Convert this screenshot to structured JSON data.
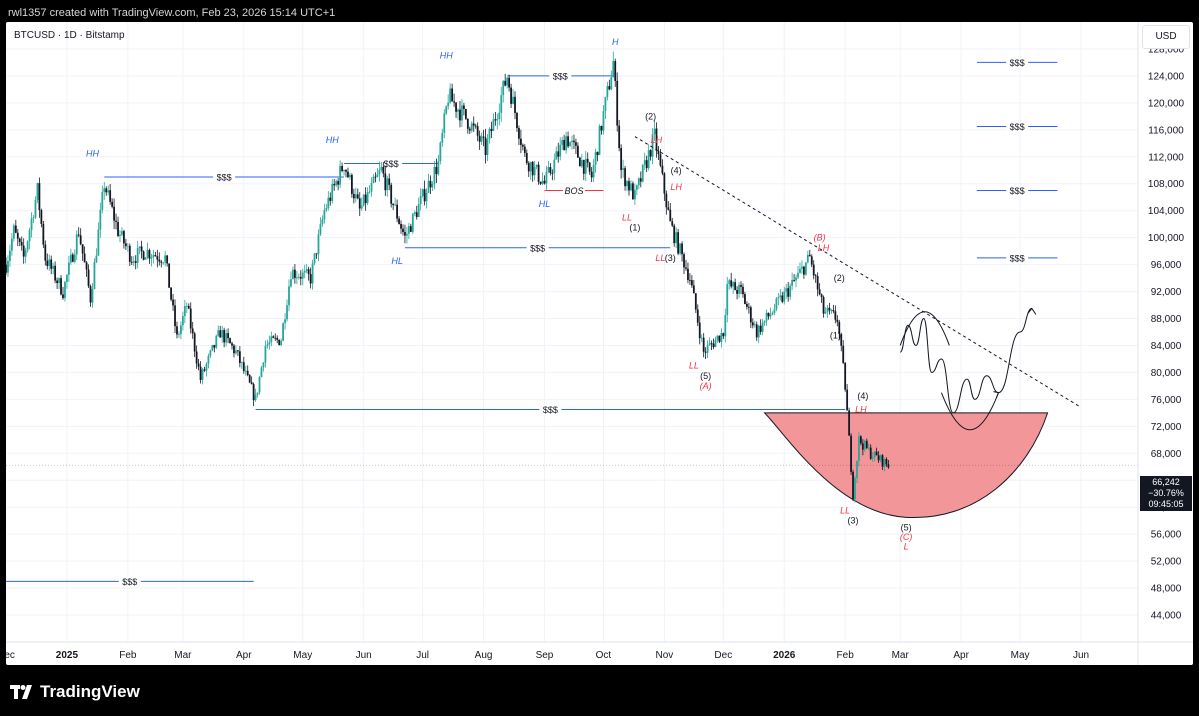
{
  "header": {
    "credit": "rwl1357 created with TradingView.com, Feb 23, 2026 15:14 UTC+1"
  },
  "chart": {
    "symbol": "BTCUSD · 1D · Bitstamp",
    "currency": "USD"
  },
  "price_badge": {
    "price": "66,242",
    "change": "−30.76%",
    "countdown": "09:45:05"
  },
  "footer": {
    "brand": "TradingView"
  },
  "colors": {
    "up": "#26a69a",
    "down": "#131722",
    "liquidity": "#2962ff",
    "structure_blue": "#2962ff",
    "structure_red": "#f23645",
    "zone": "#f28b8e",
    "wave": "#131722"
  },
  "chart_data": {
    "type": "candlestick",
    "ylim": [
      40000,
      132000
    ],
    "y_ticks": [
      44000,
      48000,
      52000,
      56000,
      60000,
      64000,
      68000,
      72000,
      76000,
      80000,
      84000,
      88000,
      92000,
      96000,
      100000,
      104000,
      108000,
      112000,
      116000,
      120000,
      124000,
      128000
    ],
    "y_tick_labels": [
      "44,000",
      "48,000",
      "52,000",
      "56,000",
      "60,000",
      "64,000",
      "68,000",
      "72,000",
      "76,000",
      "80,000",
      "84,000",
      "88,000",
      "92,000",
      "96,000",
      "100,000",
      "104,000",
      "108,000",
      "112,000",
      "116,000",
      "120,000",
      "124,000",
      "128,000"
    ],
    "x_range": [
      "2024-12-01",
      "2026-06-30"
    ],
    "x_ticks": [
      {
        "label": "Dec",
        "date": "2024-12-01",
        "bold": false
      },
      {
        "label": "2025",
        "date": "2025-01-01",
        "bold": true
      },
      {
        "label": "Feb",
        "date": "2025-02-01",
        "bold": false
      },
      {
        "label": "Mar",
        "date": "2025-03-01",
        "bold": false
      },
      {
        "label": "Apr",
        "date": "2025-04-01",
        "bold": false
      },
      {
        "label": "May",
        "date": "2025-05-01",
        "bold": false
      },
      {
        "label": "Jun",
        "date": "2025-06-01",
        "bold": false
      },
      {
        "label": "Jul",
        "date": "2025-07-01",
        "bold": false
      },
      {
        "label": "Aug",
        "date": "2025-08-01",
        "bold": false
      },
      {
        "label": "Sep",
        "date": "2025-09-01",
        "bold": false
      },
      {
        "label": "Oct",
        "date": "2025-10-01",
        "bold": false
      },
      {
        "label": "Nov",
        "date": "2025-11-01",
        "bold": false
      },
      {
        "label": "Dec",
        "date": "2025-12-01",
        "bold": false
      },
      {
        "label": "2026",
        "date": "2026-01-01",
        "bold": true
      },
      {
        "label": "Feb",
        "date": "2026-02-01",
        "bold": false
      },
      {
        "label": "Mar",
        "date": "2026-03-01",
        "bold": false
      },
      {
        "label": "Apr",
        "date": "2026-04-01",
        "bold": false
      },
      {
        "label": "May",
        "date": "2026-05-01",
        "bold": false
      },
      {
        "label": "Jun",
        "date": "2026-06-01",
        "bold": false
      }
    ],
    "price_path": [
      [
        "2024-12-01",
        96000
      ],
      [
        "2024-12-05",
        101000
      ],
      [
        "2024-12-10",
        97000
      ],
      [
        "2024-12-17",
        107000
      ],
      [
        "2024-12-21",
        97000
      ],
      [
        "2024-12-30",
        92000
      ],
      [
        "2025-01-07",
        101000
      ],
      [
        "2025-01-13",
        91000
      ],
      [
        "2025-01-20",
        108000
      ],
      [
        "2025-01-27",
        101000
      ],
      [
        "2025-02-03",
        97000
      ],
      [
        "2025-02-10",
        98000
      ],
      [
        "2025-02-20",
        97000
      ],
      [
        "2025-02-26",
        85000
      ],
      [
        "2025-03-03",
        90000
      ],
      [
        "2025-03-10",
        79000
      ],
      [
        "2025-03-20",
        86000
      ],
      [
        "2025-03-28",
        83000
      ],
      [
        "2025-04-07",
        76000
      ],
      [
        "2025-04-12",
        84000
      ],
      [
        "2025-04-20",
        85000
      ],
      [
        "2025-04-25",
        95000
      ],
      [
        "2025-05-05",
        94000
      ],
      [
        "2025-05-12",
        104000
      ],
      [
        "2025-05-22",
        111000
      ],
      [
        "2025-05-30",
        104000
      ],
      [
        "2025-06-10",
        110000
      ],
      [
        "2025-06-22",
        100000
      ],
      [
        "2025-07-01",
        106000
      ],
      [
        "2025-07-09",
        111000
      ],
      [
        "2025-07-14",
        121000
      ],
      [
        "2025-07-25",
        117000
      ],
      [
        "2025-08-02",
        113000
      ],
      [
        "2025-08-13",
        124000
      ],
      [
        "2025-08-22",
        112000
      ],
      [
        "2025-09-01",
        108000
      ],
      [
        "2025-09-12",
        115000
      ],
      [
        "2025-09-25",
        109000
      ],
      [
        "2025-10-06",
        126000
      ],
      [
        "2025-10-10",
        110000
      ],
      [
        "2025-10-17",
        106000
      ],
      [
        "2025-10-27",
        115000
      ],
      [
        "2025-11-04",
        102000
      ],
      [
        "2025-11-14",
        94000
      ],
      [
        "2025-11-21",
        83000
      ],
      [
        "2025-12-01",
        86000
      ],
      [
        "2025-12-03",
        93000
      ],
      [
        "2025-12-10",
        92000
      ],
      [
        "2025-12-18",
        86000
      ],
      [
        "2026-01-05",
        93000
      ],
      [
        "2026-01-14",
        97000
      ],
      [
        "2026-01-21",
        89000
      ],
      [
        "2026-01-28",
        88000
      ],
      [
        "2026-02-01",
        78000
      ],
      [
        "2026-02-05",
        62000
      ],
      [
        "2026-02-08",
        70000
      ],
      [
        "2026-02-14",
        68000
      ],
      [
        "2026-02-23",
        66242
      ]
    ],
    "liquidity_levels": [
      {
        "label": "$$$",
        "price": 49000,
        "from": "2024-12-01",
        "to": "2025-04-06"
      },
      {
        "label": "$$$",
        "price": 109000,
        "from": "2025-01-20",
        "to": "2025-05-22"
      },
      {
        "label": "$$$",
        "price": 111000,
        "from": "2025-05-22",
        "to": "2025-07-09"
      },
      {
        "label": "$$$",
        "price": 124000,
        "from": "2025-08-13",
        "to": "2025-10-06"
      },
      {
        "label": "$$$",
        "price": 98500,
        "from": "2025-06-22",
        "to": "2025-11-04"
      },
      {
        "label": "$$$",
        "price": 74500,
        "from": "2025-04-07",
        "to": "2026-02-01"
      },
      {
        "label": "$$$",
        "price": 126000,
        "from": "2026-04-09",
        "to": "2026-05-20"
      },
      {
        "label": "$$$",
        "price": 116500,
        "from": "2026-04-09",
        "to": "2026-05-20"
      },
      {
        "label": "$$$",
        "price": 107000,
        "from": "2026-04-09",
        "to": "2026-05-20"
      },
      {
        "label": "$$$",
        "price": 97000,
        "from": "2026-04-09",
        "to": "2026-05-20"
      }
    ],
    "bos": {
      "label": "BOS",
      "price": 107000,
      "from": "2025-09-01",
      "to": "2025-10-01"
    },
    "annotations": [
      {
        "text": "HH",
        "date": "2025-01-14",
        "price": 112500,
        "color": "blue"
      },
      {
        "text": "HH",
        "date": "2025-05-16",
        "price": 114500,
        "color": "blue"
      },
      {
        "text": "HH",
        "date": "2025-07-13",
        "price": 127000,
        "color": "blue"
      },
      {
        "text": "H",
        "date": "2025-10-07",
        "price": 129000,
        "color": "blue"
      },
      {
        "text": "HL",
        "date": "2025-06-18",
        "price": 96500,
        "color": "blue"
      },
      {
        "text": "HL",
        "date": "2025-09-01",
        "price": 105000,
        "color": "blue"
      },
      {
        "text": "LH",
        "date": "2025-10-28",
        "price": 114500,
        "color": "red"
      },
      {
        "text": "LH",
        "date": "2025-11-07",
        "price": 107500,
        "color": "red"
      },
      {
        "text": "LH",
        "date": "2026-01-21",
        "price": 98500,
        "color": "red"
      },
      {
        "text": "LH",
        "date": "2026-02-09",
        "price": 74500,
        "color": "red"
      },
      {
        "text": "LL",
        "date": "2025-10-13",
        "price": 103000,
        "color": "red"
      },
      {
        "text": "LL",
        "date": "2025-10-30",
        "price": 97000,
        "color": "red"
      },
      {
        "text": "LL",
        "date": "2025-11-16",
        "price": 81000,
        "color": "red"
      },
      {
        "text": "LL",
        "date": "2026-02-01",
        "price": 59500,
        "color": "red"
      },
      {
        "text": "(2)",
        "date": "2025-10-25",
        "price": 118000,
        "color": "dark"
      },
      {
        "text": "(1)",
        "date": "2025-10-17",
        "price": 101500,
        "color": "dark"
      },
      {
        "text": "(4)",
        "date": "2025-11-07",
        "price": 110000,
        "color": "dark"
      },
      {
        "text": "(3)",
        "date": "2025-11-04",
        "price": 97000,
        "color": "dark"
      },
      {
        "text": "(5)",
        "date": "2025-11-22",
        "price": 79500,
        "color": "dark"
      },
      {
        "text": "(A)",
        "date": "2025-11-22",
        "price": 78000,
        "color": "red"
      },
      {
        "text": "(B)",
        "date": "2026-01-19",
        "price": 100000,
        "color": "red"
      },
      {
        "text": "(2)",
        "date": "2026-01-29",
        "price": 94000,
        "color": "dark"
      },
      {
        "text": "(1)",
        "date": "2026-01-27",
        "price": 85500,
        "color": "dark"
      },
      {
        "text": "(4)",
        "date": "2026-02-10",
        "price": 76500,
        "color": "dark"
      },
      {
        "text": "(3)",
        "date": "2026-02-05",
        "price": 58000,
        "color": "dark"
      },
      {
        "text": "(5)",
        "date": "2026-03-04",
        "price": 57000,
        "color": "dark"
      },
      {
        "text": "(C)",
        "date": "2026-03-04",
        "price": 55600,
        "color": "red"
      },
      {
        "text": "L",
        "date": "2026-03-04",
        "price": 54200,
        "color": "red"
      }
    ],
    "trendline": [
      [
        "2025-10-17",
        115000
      ],
      [
        "2026-05-31",
        75000
      ]
    ],
    "demand_zone": {
      "top_price": 74000,
      "bottom_price": 58500,
      "from": "2025-12-22",
      "to": "2026-05-15"
    },
    "projection_path": [
      [
        "2026-03-01",
        83000
      ],
      [
        "2026-03-05",
        87000
      ],
      [
        "2026-03-09",
        84000
      ],
      [
        "2026-03-13",
        88000
      ],
      [
        "2026-03-17",
        80000
      ],
      [
        "2026-03-22",
        82000
      ],
      [
        "2026-03-28",
        74000
      ],
      [
        "2026-04-04",
        79000
      ],
      [
        "2026-04-08",
        76000
      ],
      [
        "2026-04-14",
        79500
      ],
      [
        "2026-04-20",
        77000
      ],
      [
        "2026-05-01",
        86000
      ],
      [
        "2026-05-07",
        89500
      ]
    ]
  }
}
